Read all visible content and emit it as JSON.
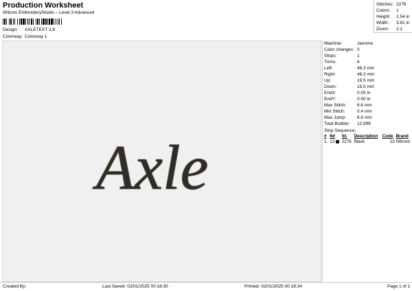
{
  "header": {
    "title": "Production Worksheet",
    "subtitle": "Wilcom EmbroideryStudio – Level 3 Advanced",
    "design_label": "Design:",
    "design_value": "AXLETEXT 3,8",
    "colorway_label": "Colorway:",
    "colorway_value": "Colorway 1"
  },
  "stats": [
    {
      "label": "Stitches:",
      "value": "2276"
    },
    {
      "label": "Colors:",
      "value": "1"
    },
    {
      "label": "Height:",
      "value": "1.54 in"
    },
    {
      "label": "Width:",
      "value": "3.81 in"
    },
    {
      "label": "Zoom:",
      "value": "1:1"
    }
  ],
  "design_preview": {
    "text": "Axle",
    "thread_color": "#2e2d27",
    "outline_color": "#7d7a70",
    "background": "#f0f0f0"
  },
  "machine_info": [
    {
      "label": "Machine:",
      "value": "Janome"
    },
    {
      "label": "Color changes:",
      "value": "0"
    },
    {
      "label": "Stops:",
      "value": "1"
    },
    {
      "label": "Trims:",
      "value": "6"
    },
    {
      "label": "Left:",
      "value": "48.3 mm"
    },
    {
      "label": "Right:",
      "value": "48.3 mm"
    },
    {
      "label": "Up:",
      "value": "19.5 mm"
    },
    {
      "label": "Down:",
      "value": "19.5 mm"
    },
    {
      "label": "EndX:",
      "value": "0.00 in"
    },
    {
      "label": "EndY:",
      "value": "0.00 in"
    },
    {
      "label": "Max Stitch:",
      "value": "6.6 mm"
    },
    {
      "label": "Min Stitch:",
      "value": "0.4 mm"
    },
    {
      "label": "Max Jump:",
      "value": "6.6 mm"
    },
    {
      "label": "Total Bobbin:",
      "value": "12.99ft"
    }
  ],
  "stop_sequence": {
    "title": "Stop Sequence:",
    "headers": [
      "#",
      "N#",
      "St.",
      "Description",
      "Code",
      "Brand"
    ],
    "rows": [
      {
        "num": "1.",
        "n": "13",
        "swatch_color": "#1a1a1a",
        "stitches": "2276",
        "description": "Black",
        "code": "13",
        "brand": "Wilcom"
      }
    ]
  },
  "footer": {
    "created_by": "Created By:",
    "last_saved": "Last Saved: 02/01/2025 00:18:30",
    "printed": "Printed: 02/01/2025 00:18:34",
    "page": "Page 1 of 1"
  }
}
